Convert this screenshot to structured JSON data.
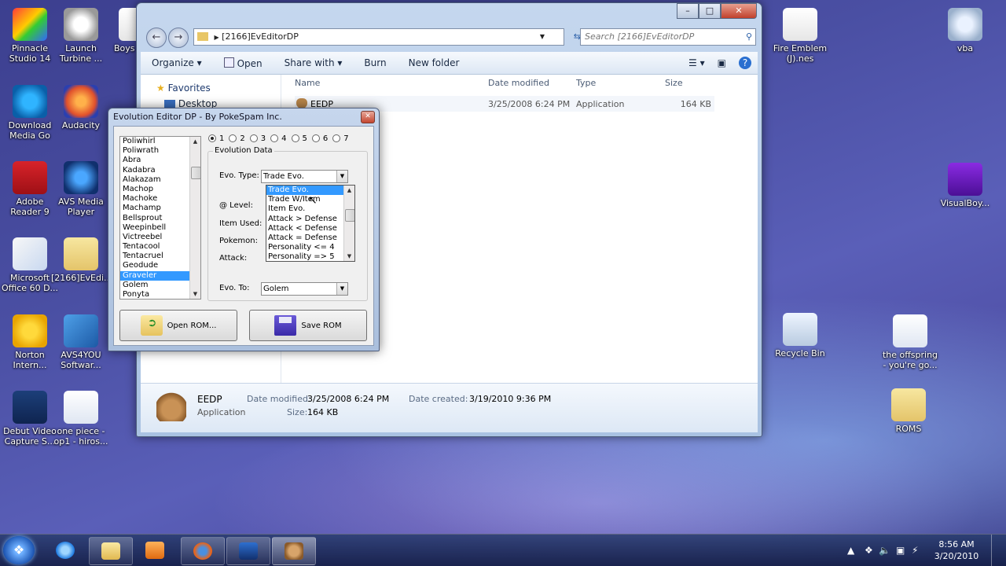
{
  "desktop_left": [
    {
      "label": "Pinnacle Studio 14",
      "icon": "pinnacle-icon"
    },
    {
      "label": "Launch Turbine ...",
      "icon": "launch-turbine-icon"
    },
    {
      "label": "Download Media Go",
      "icon": "media-go-icon"
    },
    {
      "label": "Audacity",
      "icon": "audacity-icon"
    },
    {
      "label": "Adobe Reader 9",
      "icon": "adobe-reader-icon"
    },
    {
      "label": "AVS Media Player",
      "icon": "avs-media-player-icon"
    },
    {
      "label": "Microsoft Office 60 D...",
      "icon": "office-icon"
    },
    {
      "label": "[2166]EvEdi...",
      "icon": "folder-icon"
    },
    {
      "label": "Norton Intern...",
      "icon": "norton-icon"
    },
    {
      "label": "AVS4YOU Softwar...",
      "icon": "avs4you-icon"
    },
    {
      "label": "Debut Video Capture S...",
      "icon": "debut-icon"
    },
    {
      "label": "one piece - op1 - hiros...",
      "icon": "mp3-icon"
    },
    {
      "label": "Boys Koko",
      "icon": "file-icon"
    }
  ],
  "desktop_right": [
    {
      "label": "Fire Emblem (J).nes",
      "icon": "nes-file-icon"
    },
    {
      "label": "vba",
      "icon": "vba-icon"
    },
    {
      "label": "VisualBoy...",
      "icon": "visualboy-icon"
    },
    {
      "label": "Recycle Bin",
      "icon": "recycle-bin-icon"
    },
    {
      "label": "the offspring - you're go...",
      "icon": "mp3-icon"
    },
    {
      "label": "ROMS",
      "icon": "folder-icon"
    }
  ],
  "explorer": {
    "address": "[2166]EvEditorDP",
    "search_placeholder": "Search [2166]EvEditorDP",
    "toolbar": {
      "organize": "Organize",
      "open": "Open",
      "share": "Share with",
      "burn": "Burn",
      "new_folder": "New folder"
    },
    "nav": {
      "favorites": "Favorites",
      "desktop": "Desktop"
    },
    "columns": {
      "name": "Name",
      "date": "Date modified",
      "type": "Type",
      "size": "Size"
    },
    "file": {
      "name": "EEDP",
      "date": "3/25/2008 6:24 PM",
      "type": "Application",
      "size": "164 KB"
    },
    "details": {
      "name": "EEDP",
      "kind": "Application",
      "date_modified_label": "Date modified:",
      "date_modified": "3/25/2008 6:24 PM",
      "size_label": "Size:",
      "size": "164 KB",
      "date_created_label": "Date created:",
      "date_created": "3/19/2010 9:36 PM"
    }
  },
  "evo": {
    "title": "Evolution Editor DP - By PokeSpam Inc.",
    "pokemon": [
      "Poliwhirl",
      "Poliwrath",
      "Abra",
      "Kadabra",
      "Alakazam",
      "Machop",
      "Machoke",
      "Machamp",
      "Bellsprout",
      "Weepinbell",
      "Victreebel",
      "Tentacool",
      "Tentacruel",
      "Geodude",
      "Graveler",
      "Golem",
      "Ponyta"
    ],
    "selected_pokemon": "Graveler",
    "radios": [
      "1",
      "2",
      "3",
      "4",
      "5",
      "6",
      "7"
    ],
    "group_title": "Evolution Data",
    "evo_type_label": "Evo. Type:",
    "evo_type_value": "Trade Evo.",
    "level_label": "@ Level:",
    "item_label": "Item Used:",
    "pokemon_label": "Pokemon:",
    "attack_label": "Attack:",
    "evo_to_label": "Evo. To:",
    "evo_to_value": "Golem",
    "dropdown_options": [
      "Trade Evo.",
      "Trade W/Item",
      "Item Evo.",
      "Attack > Defense",
      "Attack < Defense",
      "Attack = Defense",
      "Personality <= 4",
      "Personality => 5"
    ],
    "open_button": "Open ROM...",
    "save_button": "Save ROM"
  },
  "taskbar": {
    "time": "8:56 AM",
    "date": "3/20/2010"
  }
}
